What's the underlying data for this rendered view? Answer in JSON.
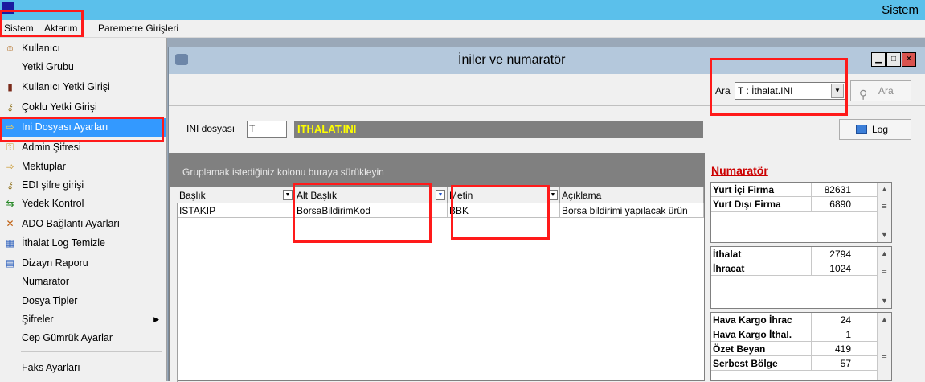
{
  "app": {
    "title": "Sistem"
  },
  "menubar": {
    "items": [
      "Sistem",
      "Aktarım",
      "Paremetre Girişleri"
    ]
  },
  "dropdown": {
    "items": [
      {
        "label": "Kullanıcı",
        "icon": "user-icon",
        "glyph": "☺"
      },
      {
        "label": "Yetki Grubu",
        "icon": "",
        "glyph": ""
      },
      {
        "label": "Kullanıcı Yetki Girişi",
        "icon": "door-icon",
        "glyph": "▮"
      },
      {
        "label": "Çoklu Yetki Girişi",
        "icon": "keys-icon",
        "glyph": "⚷"
      },
      {
        "label": "Ini Dosyası Ayarları",
        "icon": "arrow-icon",
        "glyph": "⇨",
        "selected": true
      },
      {
        "label": "Admin Şifresi",
        "icon": "key-icon",
        "glyph": "⚿"
      },
      {
        "label": "Mektuplar",
        "icon": "arrow-icon",
        "glyph": "➾"
      },
      {
        "label": "EDI şifre girişi",
        "icon": "keys-icon",
        "glyph": "⚷"
      },
      {
        "label": "Yedek Kontrol",
        "icon": "backup-icon",
        "glyph": "⇆"
      },
      {
        "label": "ADO Bağlantı Ayarları",
        "icon": "connection-icon",
        "glyph": "✕"
      },
      {
        "label": "İthalat Log Temizle",
        "icon": "clean-icon",
        "glyph": "▦"
      },
      {
        "label": "Dizayn Raporu",
        "icon": "report-icon",
        "glyph": "▤"
      },
      {
        "label": "Numarator",
        "icon": "",
        "glyph": ""
      },
      {
        "label": "Dosya Tipler",
        "icon": "",
        "glyph": ""
      },
      {
        "label": "Şifreler",
        "icon": "",
        "glyph": "",
        "submenu": true
      },
      {
        "label": "Cep Gümrük Ayarlar",
        "icon": "",
        "glyph": ""
      },
      {
        "label": "Faks Ayarları",
        "icon": "",
        "glyph": ""
      }
    ]
  },
  "window": {
    "title": "İniler ve numaratör",
    "search": {
      "label": "Ara",
      "value": "T : İthalat.INI",
      "button": "Ara"
    },
    "ini": {
      "label": "INI dosyası",
      "value": "T",
      "display": "ITHALAT.INI"
    },
    "log_button": "Log",
    "grid": {
      "group_hint": "Gruplamak istediğiniz kolonu buraya sürükleyin",
      "columns": [
        "Başlık",
        "Alt Başlık",
        "Metin",
        "Açıklama"
      ],
      "rows": [
        [
          "ISTAKIP",
          "BorsaBildirimKod",
          "BBK",
          "Borsa bildirimi yapılacak ürün"
        ]
      ]
    },
    "numarator": {
      "title": "Numaratör",
      "groups": [
        [
          {
            "name": "Yurt İçi Firma",
            "value": "82631"
          },
          {
            "name": "Yurt Dışı Firma",
            "value": "6890"
          }
        ],
        [
          {
            "name": "İthalat",
            "value": "2794"
          },
          {
            "name": "İhracat",
            "value": "1024"
          }
        ],
        [
          {
            "name": "Hava Kargo İhrac",
            "value": "24"
          },
          {
            "name": "Hava Kargo İthal.",
            "value": "1"
          },
          {
            "name": "Özet Beyan",
            "value": "419"
          },
          {
            "name": "Serbest Bölge",
            "value": "57"
          }
        ]
      ]
    }
  },
  "colors": {
    "titlebar": "#5bc0eb",
    "selection": "#3399ff",
    "highlight_box": "#ff1a1a",
    "ini_text": "#ffff00"
  }
}
